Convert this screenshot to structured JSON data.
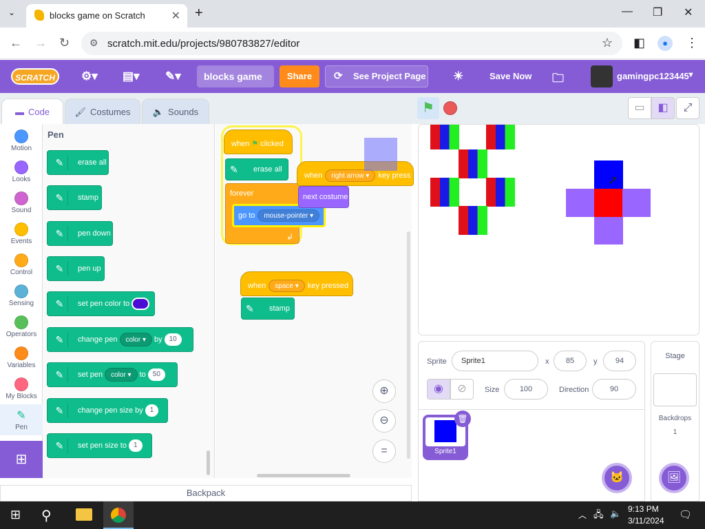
{
  "browser": {
    "tab_title": "blocks game on Scratch",
    "url": "scratch.mit.edu/projects/980783827/editor"
  },
  "menu": {
    "logo": "SCRATCH",
    "project_title": "blocks game",
    "share": "Share",
    "see_project": "See Project Page",
    "save_now": "Save Now",
    "username": "gamingpc123445"
  },
  "editor_tabs": [
    "Code",
    "Costumes",
    "Sounds"
  ],
  "categories": [
    {
      "label": "Motion",
      "color": "#4c97ff"
    },
    {
      "label": "Looks",
      "color": "#9966ff"
    },
    {
      "label": "Sound",
      "color": "#cf63cf"
    },
    {
      "label": "Events",
      "color": "#ffbf00"
    },
    {
      "label": "Control",
      "color": "#ffab19"
    },
    {
      "label": "Sensing",
      "color": "#5cb1d6"
    },
    {
      "label": "Operators",
      "color": "#59c059"
    },
    {
      "label": "Variables",
      "color": "#ff8c1a"
    },
    {
      "label": "My Blocks",
      "color": "#ff6680"
    },
    {
      "label": "Pen",
      "color": "#0fbd8c"
    }
  ],
  "palette": {
    "heading": "Pen",
    "erase_all": "erase all",
    "stamp": "stamp",
    "pen_down": "pen down",
    "pen_up": "pen up",
    "set_pen_color_to": "set pen color to",
    "change_pen": "change pen",
    "color": "color",
    "by": "by",
    "change_val": "10",
    "set_pen": "set pen",
    "to": "to",
    "set_val": "50",
    "change_size": "change pen size by",
    "size_by_val": "1",
    "set_size": "set pen size to",
    "size_to_val": "1"
  },
  "scripts": {
    "when_clicked": "when",
    "clicked": "clicked",
    "erase_all": "erase all",
    "forever": "forever",
    "go_to": "go to",
    "mouse_pointer": "mouse-pointer",
    "when2": "when",
    "right_arrow": "right arrow",
    "key_pressed2": "key press",
    "next_costume": "next costume",
    "when3": "when",
    "space": "space",
    "key_pressed3": "key pressed",
    "stamp": "stamp"
  },
  "backpack": "Backpack",
  "sprite_info": {
    "sprite_label": "Sprite",
    "sprite_name": "Sprite1",
    "x_label": "x",
    "x": "85",
    "y_label": "y",
    "y": "94",
    "size_label": "Size",
    "size": "100",
    "direction_label": "Direction",
    "direction": "90",
    "thumb_name": "Sprite1"
  },
  "stage_pane": {
    "title": "Stage",
    "backdrops_label": "Backdrops",
    "backdrops_count": "1"
  },
  "taskbar": {
    "time": "9:13 PM",
    "date": "3/11/2024"
  }
}
